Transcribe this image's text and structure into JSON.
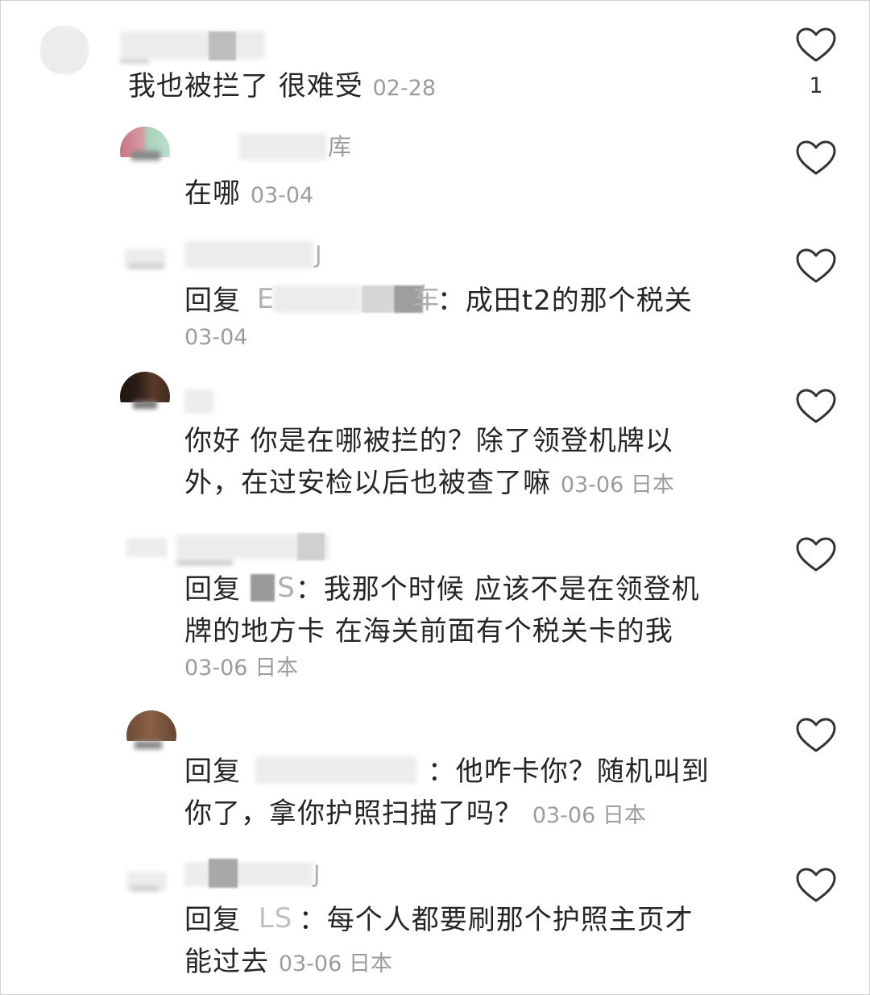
{
  "comments": [
    {
      "name": "",
      "text": "我也被拦了 很难受",
      "time": "02-28",
      "location": "",
      "likes": "1"
    },
    {
      "name_visible": "库",
      "text": "在哪",
      "time": "03-04",
      "location": "",
      "likes": ""
    },
    {
      "name_visible": "J",
      "reply_prefix": "回复",
      "reply_target_visible": "E",
      "reply_target_tail": "车",
      "text": "：成田t2的那个税关",
      "time": "03-04",
      "location": "",
      "likes": ""
    },
    {
      "name": "",
      "text_lines": [
        "你好 你是在哪被拦的？除了领登机牌以",
        "外，在过安检以后也被查了嘛"
      ],
      "time": "03-06",
      "location": "日本",
      "likes": ""
    },
    {
      "name": "",
      "reply_prefix": "回复",
      "reply_target_tail": "S",
      "text_lines": [
        "：我那个时候 应该不是在领登机",
        "牌的地方卡 在海关前面有个税关卡的我"
      ],
      "time": "03-06",
      "location": "日本",
      "likes": ""
    },
    {
      "name": "",
      "reply_prefix": "回复",
      "reply_target_tail": "",
      "text_lines": [
        "：他咋卡你？随机叫到",
        "你了，拿你护照扫描了吗？"
      ],
      "time": "03-06",
      "location": "日本",
      "likes": ""
    },
    {
      "name_visible": "J",
      "reply_prefix": "回复",
      "reply_target_visible": "LS",
      "text_lines": [
        "：每个人都要刷那个护照主页才",
        "能过去"
      ],
      "time": "03-06",
      "location": "日本",
      "likes": ""
    }
  ],
  "icons": {
    "like": "heart-outline-icon"
  },
  "colors": {
    "text": "#262626",
    "meta": "#9c9c9c",
    "heart_stroke": "#333333"
  }
}
